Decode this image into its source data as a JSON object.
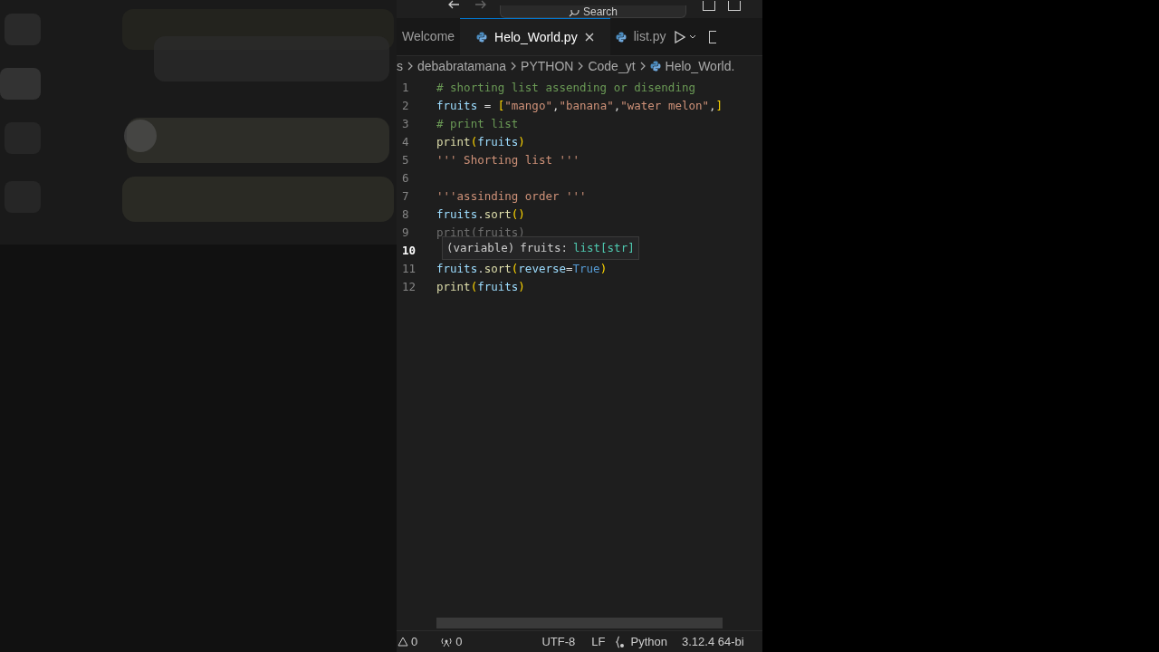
{
  "title_bar": {
    "search": "Search"
  },
  "tabs": [
    {
      "label": "Welcome",
      "selected": false,
      "python": false,
      "closable": false
    },
    {
      "label": "Helo_World.py",
      "selected": true,
      "python": true,
      "closable": true
    },
    {
      "label": "list.py",
      "selected": false,
      "python": true,
      "closable": false
    }
  ],
  "breadcrumb": [
    "s",
    "debabratamana",
    "PYTHON",
    "Code_yt",
    "Helo_World."
  ],
  "code_lines": [
    {
      "number": "1",
      "current": false,
      "tokens": [
        {
          "text": "# shorting list assending or disending",
          "kind": "comment"
        }
      ]
    },
    {
      "number": "2",
      "current": false,
      "tokens": [
        {
          "text": "fruits",
          "kind": "var"
        },
        {
          "text": " = ",
          "kind": "op"
        },
        {
          "text": "[",
          "kind": "bracket"
        },
        {
          "text": "\"mango\"",
          "kind": "string"
        },
        {
          "text": ",",
          "kind": "op"
        },
        {
          "text": "\"banana\"",
          "kind": "string"
        },
        {
          "text": ",",
          "kind": "op"
        },
        {
          "text": "\"water melon\"",
          "kind": "string"
        },
        {
          "text": ",",
          "kind": "op"
        },
        {
          "text": "]",
          "kind": "bracket"
        }
      ]
    },
    {
      "number": "3",
      "current": false,
      "tokens": [
        {
          "text": "# print list",
          "kind": "comment"
        }
      ]
    },
    {
      "number": "4",
      "current": false,
      "tokens": [
        {
          "text": "print",
          "kind": "func"
        },
        {
          "text": "(",
          "kind": "bracket"
        },
        {
          "text": "fruits",
          "kind": "var"
        },
        {
          "text": ")",
          "kind": "bracket"
        }
      ]
    },
    {
      "number": "5",
      "current": false,
      "tokens": [
        {
          "text": "''' Shorting list '''",
          "kind": "string"
        }
      ]
    },
    {
      "number": "6",
      "current": false
    },
    {
      "number": "7",
      "current": false,
      "tokens": [
        {
          "text": "'''assinding order '''",
          "kind": "string"
        }
      ]
    },
    {
      "number": "8",
      "current": false,
      "tokens": [
        {
          "text": "fruits",
          "kind": "var"
        },
        {
          "text": ".",
          "kind": "op"
        },
        {
          "text": "sort",
          "kind": "func"
        },
        {
          "text": "()",
          "kind": "bracket"
        }
      ]
    },
    {
      "number": "9",
      "current": false,
      "tokens": [
        {
          "text": "print(fruits)",
          "kind": "faded"
        }
      ]
    },
    {
      "number": "10",
      "current": true
    },
    {
      "number": "11",
      "current": false,
      "tokens": [
        {
          "text": "fruits",
          "kind": "var"
        },
        {
          "text": ".",
          "kind": "op"
        },
        {
          "text": "sort",
          "kind": "func"
        },
        {
          "text": "(",
          "kind": "bracket"
        },
        {
          "text": "reverse",
          "kind": "var"
        },
        {
          "text": "=",
          "kind": "op"
        },
        {
          "text": "True",
          "kind": "constant"
        },
        {
          "text": ")",
          "kind": "bracket"
        }
      ]
    },
    {
      "number": "12",
      "current": false,
      "tokens": [
        {
          "text": "print",
          "kind": "func"
        },
        {
          "text": "(",
          "kind": "bracket"
        },
        {
          "text": "fruits",
          "kind": "var"
        },
        {
          "text": ")",
          "kind": "bracket"
        }
      ]
    }
  ],
  "hover": {
    "label": "(variable)",
    "name": "fruits:",
    "type": "list[str]"
  },
  "status_bar": {
    "warnings": "0",
    "ports": "0",
    "encoding": "UTF-8",
    "eol": "LF",
    "language": "Python",
    "interpreter": "3.12.4 64-bi"
  }
}
